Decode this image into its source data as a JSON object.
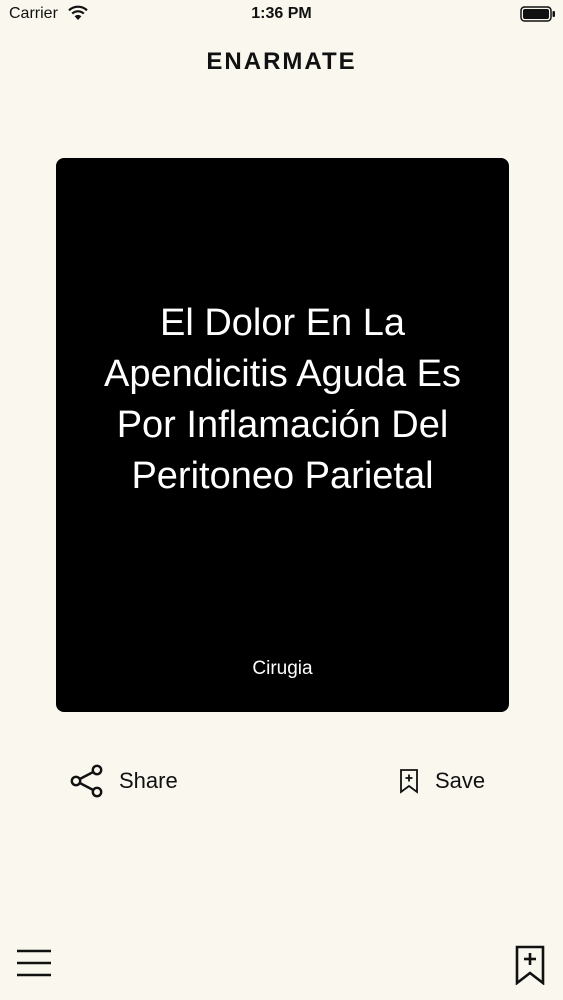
{
  "status_bar": {
    "carrier": "Carrier",
    "time": "1:36 PM",
    "wifi_icon": "wifi-icon",
    "battery_icon": "battery-icon"
  },
  "header": {
    "title": "ENARMATE"
  },
  "card": {
    "text": "El Dolor En La Apendicitis Aguda Es Por Inflamación Del Peritoneo Parietal",
    "category": "Cirugia",
    "background": "#000000",
    "text_color": "#ffffff"
  },
  "actions": {
    "share_label": "Share",
    "share_icon": "share-icon",
    "save_label": "Save",
    "save_icon": "bookmark-add-icon"
  },
  "tab_bar": {
    "menu_icon": "menu-icon",
    "bookmarks_icon": "bookmark-add-icon"
  },
  "colors": {
    "page_background": "#f9f7ee",
    "text": "#111111"
  }
}
